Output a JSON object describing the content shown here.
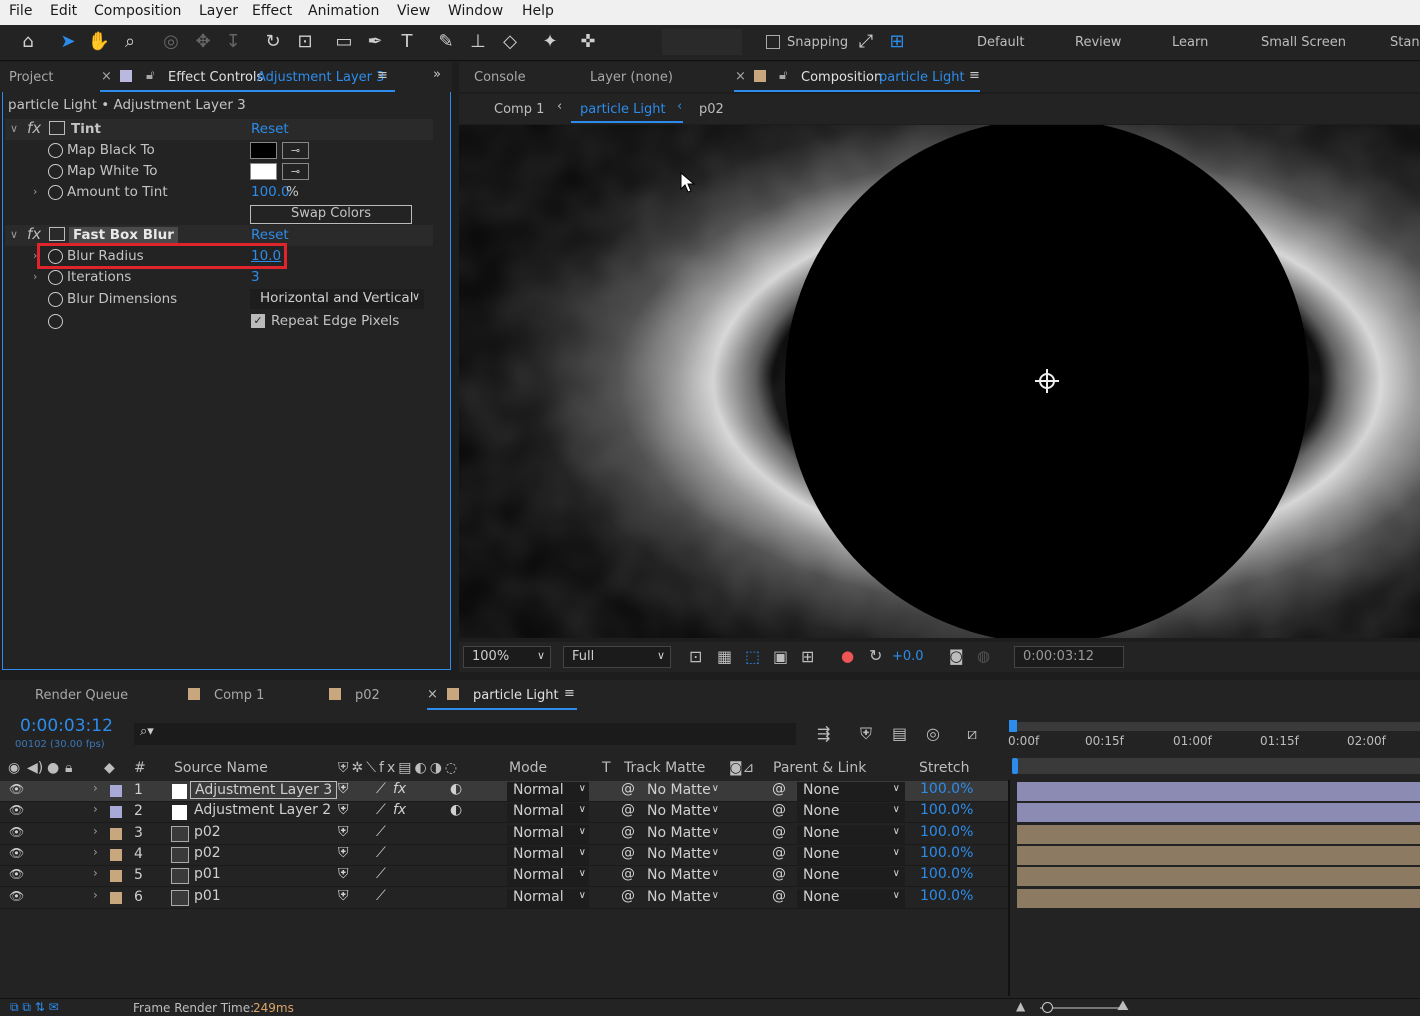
{
  "menu": [
    "File",
    "Edit",
    "Composition",
    "Layer",
    "Effect",
    "Animation",
    "View",
    "Window",
    "Help"
  ],
  "toolbar": {
    "snapping": "Snapping",
    "workspaces": [
      "Default",
      "Review",
      "Learn",
      "Small Screen",
      "Stanc"
    ]
  },
  "left_tabs": {
    "project": "Project",
    "effect_controls": "Effect Controls",
    "effect_layer": "Adjustment Layer 3"
  },
  "effect": {
    "breadcrumb": "particle Light • Adjustment Layer 3",
    "tint": {
      "name": "Tint",
      "reset": "Reset",
      "map_black": "Map Black To",
      "map_white": "Map White To",
      "amount": "Amount to Tint",
      "amount_val": "100.0",
      "amount_unit": "%",
      "swap": "Swap Colors"
    },
    "blur": {
      "name": "Fast Box Blur",
      "reset": "Reset",
      "radius": "Blur Radius",
      "radius_val": "10.0",
      "iterations": "Iterations",
      "iterations_val": "3",
      "dims": "Blur Dimensions",
      "dims_val": "Horizontal and Vertical",
      "repeat": "Repeat Edge Pixels"
    }
  },
  "right_tabs": {
    "console": "Console",
    "layer": "Layer (none)",
    "composition": "Composition",
    "comp_name": "particle Light"
  },
  "breadcrumbs": [
    "Comp 1",
    "particle Light",
    "p02"
  ],
  "viewer_ctl": {
    "zoom": "100%",
    "res": "Full",
    "exposure": "+0.0",
    "time": "0:00:03:12"
  },
  "tl_tabs": [
    "Render Queue",
    "Comp 1",
    "p02",
    "particle Light"
  ],
  "timecode": "0:00:03:12",
  "frames": "00102 (30.00 fps)",
  "ruler": [
    "0:00f",
    "00:15f",
    "01:00f",
    "01:15f",
    "02:00f"
  ],
  "cols": {
    "num": "#",
    "source": "Source Name",
    "mode": "Mode",
    "t": "T",
    "matte": "Track Matte",
    "parent": "Parent & Link",
    "stretch": "Stretch"
  },
  "layers": [
    {
      "n": "1",
      "name": "Adjustment Layer 3",
      "mode": "Normal",
      "matte": "No Matte",
      "parent": "None",
      "stretch": "100.0%",
      "color": "#a9a9d8",
      "adj": true
    },
    {
      "n": "2",
      "name": "Adjustment Layer 2",
      "mode": "Normal",
      "matte": "No Matte",
      "parent": "None",
      "stretch": "100.0%",
      "color": "#a9a9d8",
      "adj": true
    },
    {
      "n": "3",
      "name": "p02",
      "mode": "Normal",
      "matte": "No Matte",
      "parent": "None",
      "stretch": "100.0%",
      "color": "#c9a77e",
      "adj": false
    },
    {
      "n": "4",
      "name": "p02",
      "mode": "Normal",
      "matte": "No Matte",
      "parent": "None",
      "stretch": "100.0%",
      "color": "#c9a77e",
      "adj": false
    },
    {
      "n": "5",
      "name": "p01",
      "mode": "Normal",
      "matte": "No Matte",
      "parent": "None",
      "stretch": "100.0%",
      "color": "#c9a77e",
      "adj": false
    },
    {
      "n": "6",
      "name": "p01",
      "mode": "Normal",
      "matte": "No Matte",
      "parent": "None",
      "stretch": "100.0%",
      "color": "#c9a77e",
      "adj": false
    }
  ],
  "status": {
    "label": "Frame Render Time:",
    "value": "249ms"
  }
}
